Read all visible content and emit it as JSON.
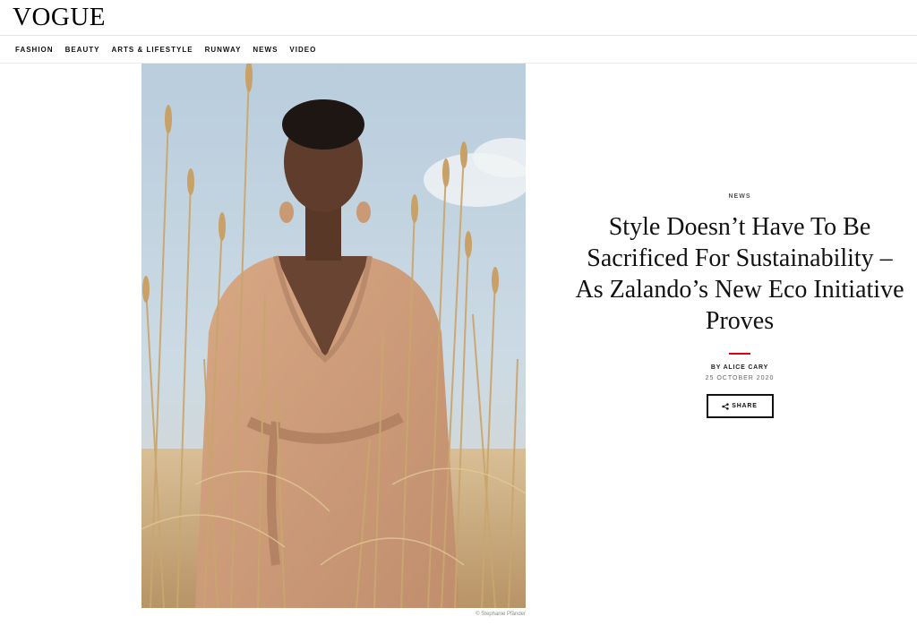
{
  "header": {
    "logo": "VOGUE"
  },
  "nav": {
    "items": [
      "FASHION",
      "BEAUTY",
      "ARTS & LIFESTYLE",
      "RUNWAY",
      "NEWS",
      "VIDEO"
    ]
  },
  "hero": {
    "credit": "© Stephanie Pfänder"
  },
  "article": {
    "kicker": "NEWS",
    "headline": "Style Doesn’t Have To Be Sacrificed For Sustainability – As Zalando’s New Eco Initiative Proves",
    "byline": "BY ALICE CARY",
    "date": "25 OCTOBER 2020",
    "share_label": "SHARE"
  },
  "colors": {
    "accent_rule": "#e4001b",
    "text": "#111111"
  }
}
